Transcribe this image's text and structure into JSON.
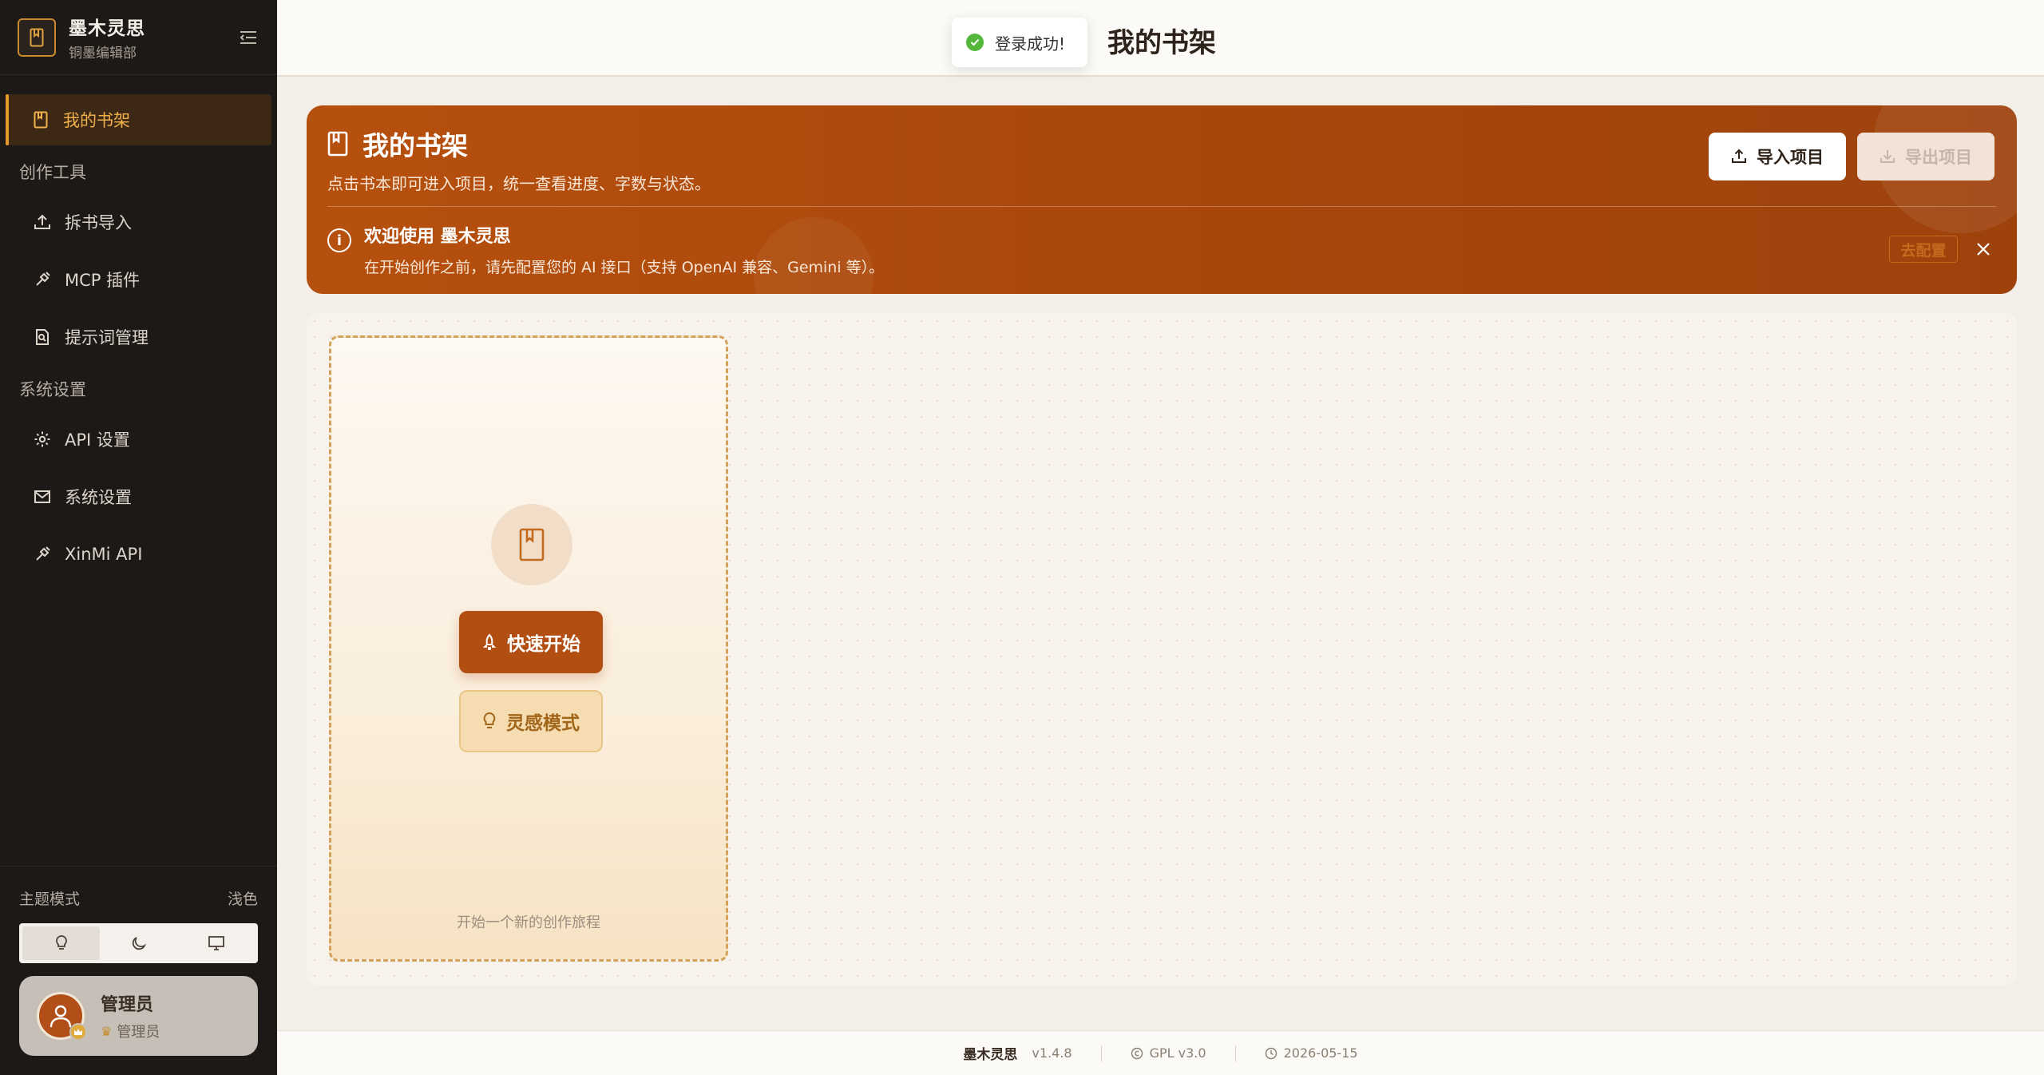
{
  "app": {
    "name": "墨木灵思",
    "subtitle": "铜墨编辑部"
  },
  "nav": {
    "primary": {
      "label": "我的书架",
      "icon": "book-icon",
      "active": true
    },
    "groups": [
      {
        "label": "创作工具",
        "items": [
          {
            "label": "拆书导入",
            "icon": "upload-icon"
          },
          {
            "label": "MCP 插件",
            "icon": "plug-icon"
          },
          {
            "label": "提示词管理",
            "icon": "file-search-icon"
          }
        ]
      },
      {
        "label": "系统设置",
        "items": [
          {
            "label": "API 设置",
            "icon": "gear-icon"
          },
          {
            "label": "系统设置",
            "icon": "mail-icon"
          },
          {
            "label": "XinMi API",
            "icon": "plug-icon"
          }
        ]
      }
    ]
  },
  "theme": {
    "label": "主题模式",
    "current": "浅色",
    "options": [
      "light",
      "dark",
      "system"
    ]
  },
  "user": {
    "name": "管理员",
    "role": "管理员"
  },
  "header": {
    "title": "我的书架"
  },
  "toast": {
    "message": "登录成功!"
  },
  "hero": {
    "title": "我的书架",
    "subtitle": "点击书本即可进入项目，统一查看进度、字数与状态。",
    "import_label": "导入项目",
    "export_label": "导出项目",
    "notice_title": "欢迎使用 墨木灵思",
    "notice_text": "在开始创作之前，请先配置您的 AI 接口（支持 OpenAI 兼容、Gemini 等）。",
    "configure_label": "去配置"
  },
  "shelf": {
    "quick_start_label": "快速开始",
    "inspiration_label": "灵感模式",
    "hint": "开始一个新的创作旅程"
  },
  "footer": {
    "name": "墨木灵思",
    "version": "v1.4.8",
    "license": "GPL v3.0",
    "date": "2026-05-15"
  },
  "colors": {
    "accent": "#b24e12",
    "sidebar_bg": "#1d1917",
    "active_text": "#f0b14a"
  }
}
